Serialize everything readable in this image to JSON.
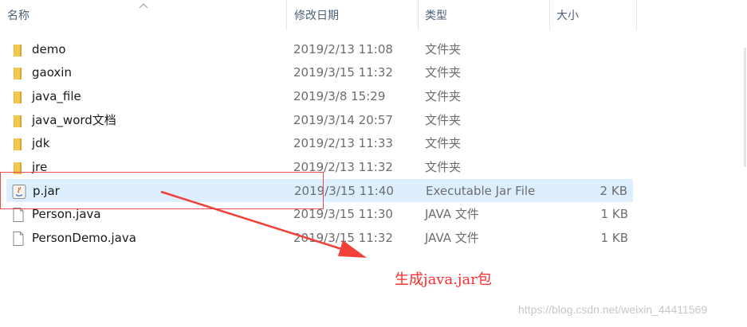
{
  "columns": {
    "name": "名称",
    "date": "修改日期",
    "type": "类型",
    "size": "大小"
  },
  "rows": [
    {
      "name": "demo",
      "date": "2019/2/13 11:08",
      "type": "文件夹",
      "size": "",
      "icon": "folder-icon"
    },
    {
      "name": "gaoxin",
      "date": "2019/3/15 11:32",
      "type": "文件夹",
      "size": "",
      "icon": "folder-icon"
    },
    {
      "name": "java_file",
      "date": "2019/3/8 15:29",
      "type": "文件夹",
      "size": "",
      "icon": "folder-icon"
    },
    {
      "name": "java_word文档",
      "date": "2019/3/14 20:57",
      "type": "文件夹",
      "size": "",
      "icon": "folder-icon"
    },
    {
      "name": "jdk",
      "date": "2019/2/13 11:33",
      "type": "文件夹",
      "size": "",
      "icon": "folder-icon"
    },
    {
      "name": "jre",
      "date": "2019/2/13 11:32",
      "type": "文件夹",
      "size": "",
      "icon": "folder-icon"
    },
    {
      "name": "p.jar",
      "date": "2019/3/15 11:40",
      "type": "Executable Jar File",
      "size": "2 KB",
      "icon": "jar-file-icon",
      "selected": true
    },
    {
      "name": "Person.java",
      "date": "2019/3/15 11:30",
      "type": "JAVA 文件",
      "size": "1 KB",
      "icon": "document-icon"
    },
    {
      "name": "PersonDemo.java",
      "date": "2019/3/15 11:32",
      "type": "JAVA 文件",
      "size": "1 KB",
      "icon": "document-icon"
    }
  ],
  "annotation": {
    "text": "生成java.jar包",
    "color": "#ff2a2a"
  },
  "watermark": "https://blog.csdn.net/weixin_44411569",
  "colors": {
    "folder": "#f2c94c",
    "selection": "#ddeeff",
    "header_text": "#4c607a"
  }
}
